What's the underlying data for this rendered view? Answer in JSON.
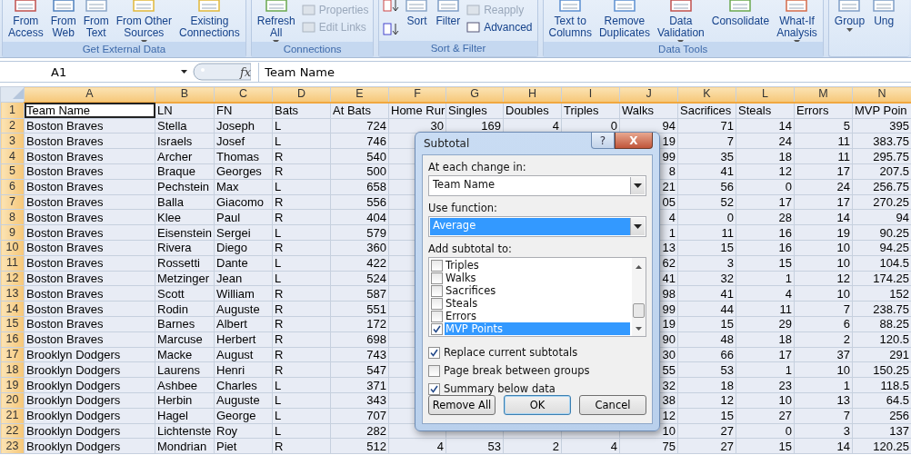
{
  "ribbon": {
    "groups": [
      {
        "label": "Get External Data",
        "items": [
          {
            "kind": "large",
            "lines": [
              "From",
              "Access"
            ],
            "dropdown": false
          },
          {
            "kind": "large",
            "lines": [
              "From",
              "Web"
            ],
            "dropdown": false
          },
          {
            "kind": "large",
            "lines": [
              "From",
              "Text"
            ],
            "dropdown": false
          },
          {
            "kind": "large",
            "lines": [
              "From Other",
              "Sources"
            ],
            "dropdown": true
          },
          {
            "kind": "large",
            "lines": [
              "Existing",
              "Connections"
            ],
            "dropdown": false
          }
        ]
      },
      {
        "label": "Connections",
        "items": [
          {
            "kind": "large",
            "lines": [
              "Refresh",
              "All"
            ],
            "dropdown": true
          },
          {
            "kind": "stack",
            "entries": [
              {
                "label": "Properties",
                "disabled": true
              },
              {
                "label": "Edit Links",
                "disabled": true
              }
            ]
          }
        ]
      },
      {
        "label": "Sort & Filter",
        "items": [
          {
            "kind": "sorticons"
          },
          {
            "kind": "large",
            "lines": [
              "Sort"
            ],
            "dropdown": false
          },
          {
            "kind": "large",
            "lines": [
              "Filter"
            ],
            "dropdown": false
          },
          {
            "kind": "stack",
            "entries": [
              {
                "label": "Reapply",
                "disabled": true
              },
              {
                "label": "Advanced",
                "disabled": false
              }
            ]
          }
        ]
      },
      {
        "label": "Data Tools",
        "items": [
          {
            "kind": "large",
            "lines": [
              "Text to",
              "Columns"
            ],
            "dropdown": false
          },
          {
            "kind": "large",
            "lines": [
              "Remove",
              "Duplicates"
            ],
            "dropdown": false
          },
          {
            "kind": "large",
            "lines": [
              "Data",
              "Validation"
            ],
            "dropdown": true
          },
          {
            "kind": "large",
            "lines": [
              "Consolidate"
            ],
            "dropdown": false
          },
          {
            "kind": "large",
            "lines": [
              "What-If",
              "Analysis"
            ],
            "dropdown": true
          }
        ]
      },
      {
        "items": [
          {
            "kind": "large",
            "lines": [
              "Group"
            ],
            "dropdown": true
          },
          {
            "kind": "large",
            "lines": [
              "Ung"
            ]
          }
        ]
      }
    ]
  },
  "formula_bar": {
    "name_box": "A1",
    "function_label": "fx",
    "value": "Team Name"
  },
  "sheet": {
    "columns": [
      "A",
      "B",
      "C",
      "D",
      "E",
      "F",
      "G",
      "H",
      "I",
      "J",
      "K",
      "L",
      "M",
      "N"
    ],
    "rows": [
      {
        "number": "1",
        "cells": [
          "Team Name",
          "LN",
          "FN",
          "Bats",
          "At Bats",
          "Home Rur",
          "Singles",
          "Doubles",
          "Triples",
          "Walks",
          "Sacrifices",
          "Steals",
          "Errors",
          "MVP Poin"
        ]
      },
      {
        "number": "2",
        "cells": [
          "Boston Braves",
          "Stella",
          "Joseph",
          "L",
          "724",
          "30",
          "169",
          "4",
          "0",
          "94",
          "71",
          "14",
          "5",
          "395"
        ]
      },
      {
        "number": "3",
        "cells": [
          "Boston Braves",
          "Israels",
          "Josef",
          "L",
          "746",
          null,
          null,
          null,
          null,
          "19",
          "7",
          "24",
          "11",
          "383.75"
        ]
      },
      {
        "number": "4",
        "cells": [
          "Boston Braves",
          "Archer",
          "Thomas",
          "R",
          "540",
          null,
          null,
          null,
          null,
          "99",
          "35",
          "18",
          "11",
          "295.75"
        ]
      },
      {
        "number": "5",
        "cells": [
          "Boston Braves",
          "Braque",
          "Georges",
          "R",
          "500",
          null,
          null,
          null,
          null,
          "8",
          "41",
          "12",
          "17",
          "207.5"
        ]
      },
      {
        "number": "6",
        "cells": [
          "Boston Braves",
          "Pechstein",
          "Max",
          "L",
          "658",
          null,
          null,
          null,
          null,
          "21",
          "56",
          "0",
          "24",
          "256.75"
        ]
      },
      {
        "number": "7",
        "cells": [
          "Boston Braves",
          "Balla",
          "Giacomo",
          "R",
          "556",
          null,
          null,
          null,
          null,
          "05",
          "52",
          "17",
          "17",
          "270.25"
        ]
      },
      {
        "number": "8",
        "cells": [
          "Boston Braves",
          "Klee",
          "Paul",
          "R",
          "404",
          null,
          null,
          null,
          null,
          "4",
          "0",
          "28",
          "14",
          "94"
        ]
      },
      {
        "number": "9",
        "cells": [
          "Boston Braves",
          "Eisenstein",
          "Sergei",
          "L",
          "579",
          null,
          null,
          null,
          null,
          "1",
          "11",
          "16",
          "19",
          "90.25"
        ]
      },
      {
        "number": "10",
        "cells": [
          "Boston Braves",
          "Rivera",
          "Diego",
          "R",
          "360",
          null,
          null,
          null,
          null,
          "13",
          "15",
          "16",
          "10",
          "94.25"
        ]
      },
      {
        "number": "11",
        "cells": [
          "Boston Braves",
          "Rossetti",
          "Dante",
          "L",
          "422",
          null,
          null,
          null,
          null,
          "62",
          "3",
          "15",
          "10",
          "104.5"
        ]
      },
      {
        "number": "12",
        "cells": [
          "Boston Braves",
          "Metzinger",
          "Jean",
          "L",
          "524",
          null,
          null,
          null,
          null,
          "41",
          "32",
          "1",
          "12",
          "174.25"
        ]
      },
      {
        "number": "13",
        "cells": [
          "Boston Braves",
          "Scott",
          "William",
          "R",
          "587",
          null,
          null,
          null,
          null,
          "98",
          "41",
          "4",
          "10",
          "152"
        ]
      },
      {
        "number": "14",
        "cells": [
          "Boston Braves",
          "Rodin",
          "Auguste",
          "R",
          "551",
          null,
          null,
          null,
          null,
          "99",
          "44",
          "11",
          "7",
          "238.75"
        ]
      },
      {
        "number": "15",
        "cells": [
          "Boston Braves",
          "Barnes",
          "Albert",
          "R",
          "172",
          null,
          null,
          null,
          null,
          "19",
          "15",
          "29",
          "6",
          "88.25"
        ]
      },
      {
        "number": "16",
        "cells": [
          "Boston Braves",
          "Marcuse",
          "Herbert",
          "R",
          "698",
          null,
          null,
          null,
          null,
          "90",
          "48",
          "18",
          "2",
          "120.5"
        ]
      },
      {
        "number": "17",
        "cells": [
          "Brooklyn Dodgers",
          "Macke",
          "August",
          "R",
          "743",
          null,
          null,
          null,
          null,
          "30",
          "66",
          "17",
          "37",
          "291"
        ]
      },
      {
        "number": "18",
        "cells": [
          "Brooklyn Dodgers",
          "Laurens",
          "Henri",
          "R",
          "547",
          null,
          null,
          null,
          null,
          "55",
          "53",
          "1",
          "10",
          "150.25"
        ]
      },
      {
        "number": "19",
        "cells": [
          "Brooklyn Dodgers",
          "Ashbee",
          "Charles",
          "L",
          "371",
          null,
          null,
          null,
          null,
          "32",
          "18",
          "23",
          "1",
          "118.5"
        ]
      },
      {
        "number": "20",
        "cells": [
          "Brooklyn Dodgers",
          "Herbin",
          "Auguste",
          "L",
          "343",
          null,
          null,
          null,
          null,
          "38",
          "12",
          "10",
          "13",
          "64.5"
        ]
      },
      {
        "number": "21",
        "cells": [
          "Brooklyn Dodgers",
          "Hagel",
          "George",
          "L",
          "707",
          null,
          null,
          null,
          null,
          "12",
          "15",
          "27",
          "7",
          "256"
        ]
      },
      {
        "number": "22",
        "cells": [
          "Brooklyn Dodgers",
          "Lichtenste",
          "Roy",
          "L",
          "282",
          null,
          null,
          null,
          null,
          "10",
          "27",
          "0",
          "3",
          "137"
        ]
      },
      {
        "number": "23",
        "cells": [
          "Brooklyn Dodgers",
          "Mondrian",
          "Piet",
          "R",
          "512",
          "4",
          "53",
          "2",
          "4",
          "75",
          "27",
          "15",
          "14",
          "120.25"
        ]
      }
    ]
  },
  "dialog": {
    "title": "Subtotal",
    "help": "?",
    "close": "X",
    "change_label": "At each change in:",
    "change_value": "Team Name",
    "function_label": "Use function:",
    "function_value": "Average",
    "function_selected": true,
    "add_label": "Add subtotal to:",
    "add_items": [
      {
        "label": "Triples",
        "checked": false,
        "selected": false
      },
      {
        "label": "Walks",
        "checked": false,
        "selected": false
      },
      {
        "label": "Sacrifices",
        "checked": false,
        "selected": false
      },
      {
        "label": "Steals",
        "checked": false,
        "selected": false
      },
      {
        "label": "Errors",
        "checked": false,
        "selected": false
      },
      {
        "label": "MVP Points",
        "checked": true,
        "selected": true
      }
    ],
    "options": [
      {
        "label": "Replace current subtotals",
        "checked": true
      },
      {
        "label": "Page break between groups",
        "checked": false
      },
      {
        "label": "Summary below data",
        "checked": true
      }
    ],
    "buttons": [
      {
        "label": "Remove All",
        "default": false
      },
      {
        "label": "OK",
        "default": true
      },
      {
        "label": "Cancel",
        "default": false
      }
    ]
  }
}
